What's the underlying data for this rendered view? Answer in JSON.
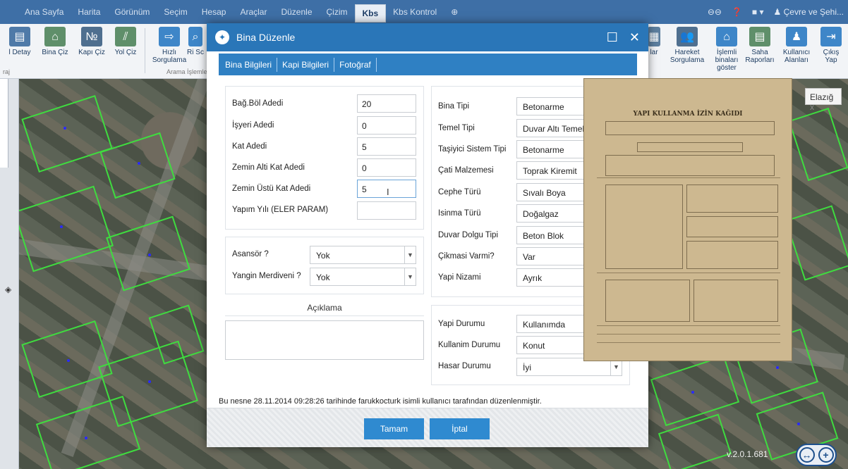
{
  "menu": {
    "items": [
      "Ana Sayfa",
      "Harita",
      "Görünüm",
      "Seçim",
      "Hesap",
      "Araçlar",
      "Düzenle",
      "Çizim",
      "Kbs",
      "Kbs Kontrol"
    ],
    "active_index": 8,
    "user": "Çevre ve Şehi..."
  },
  "ribbon": {
    "left_buttons": [
      "l Detay",
      "Bina Çiz",
      "Kapı Çiz",
      "Yol Çiz"
    ],
    "mid_buttons": [
      "Hızlı Sorgulama",
      "Ri Sc"
    ],
    "group_label": "Arama İşlemleri",
    "left_group": "raj",
    "right_buttons": [
      "lar",
      "Hareket Sorgulama",
      "İşlemli binaları göster",
      "Saha Raporları",
      "Kullanıcı Alanları",
      "Çıkış Yap"
    ]
  },
  "map": {
    "city_label": "Elazığ",
    "city_close": "x",
    "version": "v.2.0.1.681"
  },
  "dialog": {
    "title": "Bina Düzenle",
    "tabs": [
      "Bina Bilgileri",
      "Kapi Bilgileri",
      "Fotoğraf"
    ],
    "left_fields": [
      {
        "label": "Bağ.Böl Adedi",
        "value": "20"
      },
      {
        "label": "İşyeri Adedi",
        "value": "0"
      },
      {
        "label": "Kat Adedi",
        "value": "5"
      },
      {
        "label": "Zemin Alti Kat Adedi",
        "value": "0"
      },
      {
        "label": "Zemin Üstü Kat Adedi",
        "value": "5"
      },
      {
        "label": "Yapım Yılı (ELER PARAM)",
        "value": ""
      }
    ],
    "yesno_fields": [
      {
        "label": "Asansör ?",
        "value": "Yok"
      },
      {
        "label": "Yangin Merdiveni ?",
        "value": "Yok"
      }
    ],
    "description_label": "Açıklama",
    "right_fields": [
      {
        "label": "Bina Tipi",
        "value": "Betonarme"
      },
      {
        "label": "Temel Tipi",
        "value": "Duvar Altı Temel"
      },
      {
        "label": "Taşiyici Sistem Tipi",
        "value": "Betonarme"
      },
      {
        "label": "Çati Malzemesi",
        "value": "Toprak Kiremit"
      },
      {
        "label": "Cephe Türü",
        "value": "Sıvalı Boya"
      },
      {
        "label": "Isinma Türü",
        "value": "Doğalgaz"
      },
      {
        "label": "Duvar Dolgu Tipi",
        "value": "Beton Blok"
      },
      {
        "label": "Çikmasi Varmi?",
        "value": "Var"
      },
      {
        "label": "Yapi Nizami",
        "value": "Ayrık"
      }
    ],
    "status_fields": [
      {
        "label": "Yapi Durumu",
        "value": "Kullanımda"
      },
      {
        "label": "Kullanim Durumu",
        "value": "Konut"
      },
      {
        "label": "Hasar Durumu",
        "value": "İyi"
      }
    ],
    "footer_note": "Bu nesne 28.11.2014 09:28:26 tarihinde farukkocturk isimli kullanıcı tarafından düzenlenmiştir.",
    "ok_label": "Tamam",
    "cancel_label": "İptal"
  },
  "scan": {
    "header": "YAPI KULLANMA İZİN KAĞIDI"
  }
}
